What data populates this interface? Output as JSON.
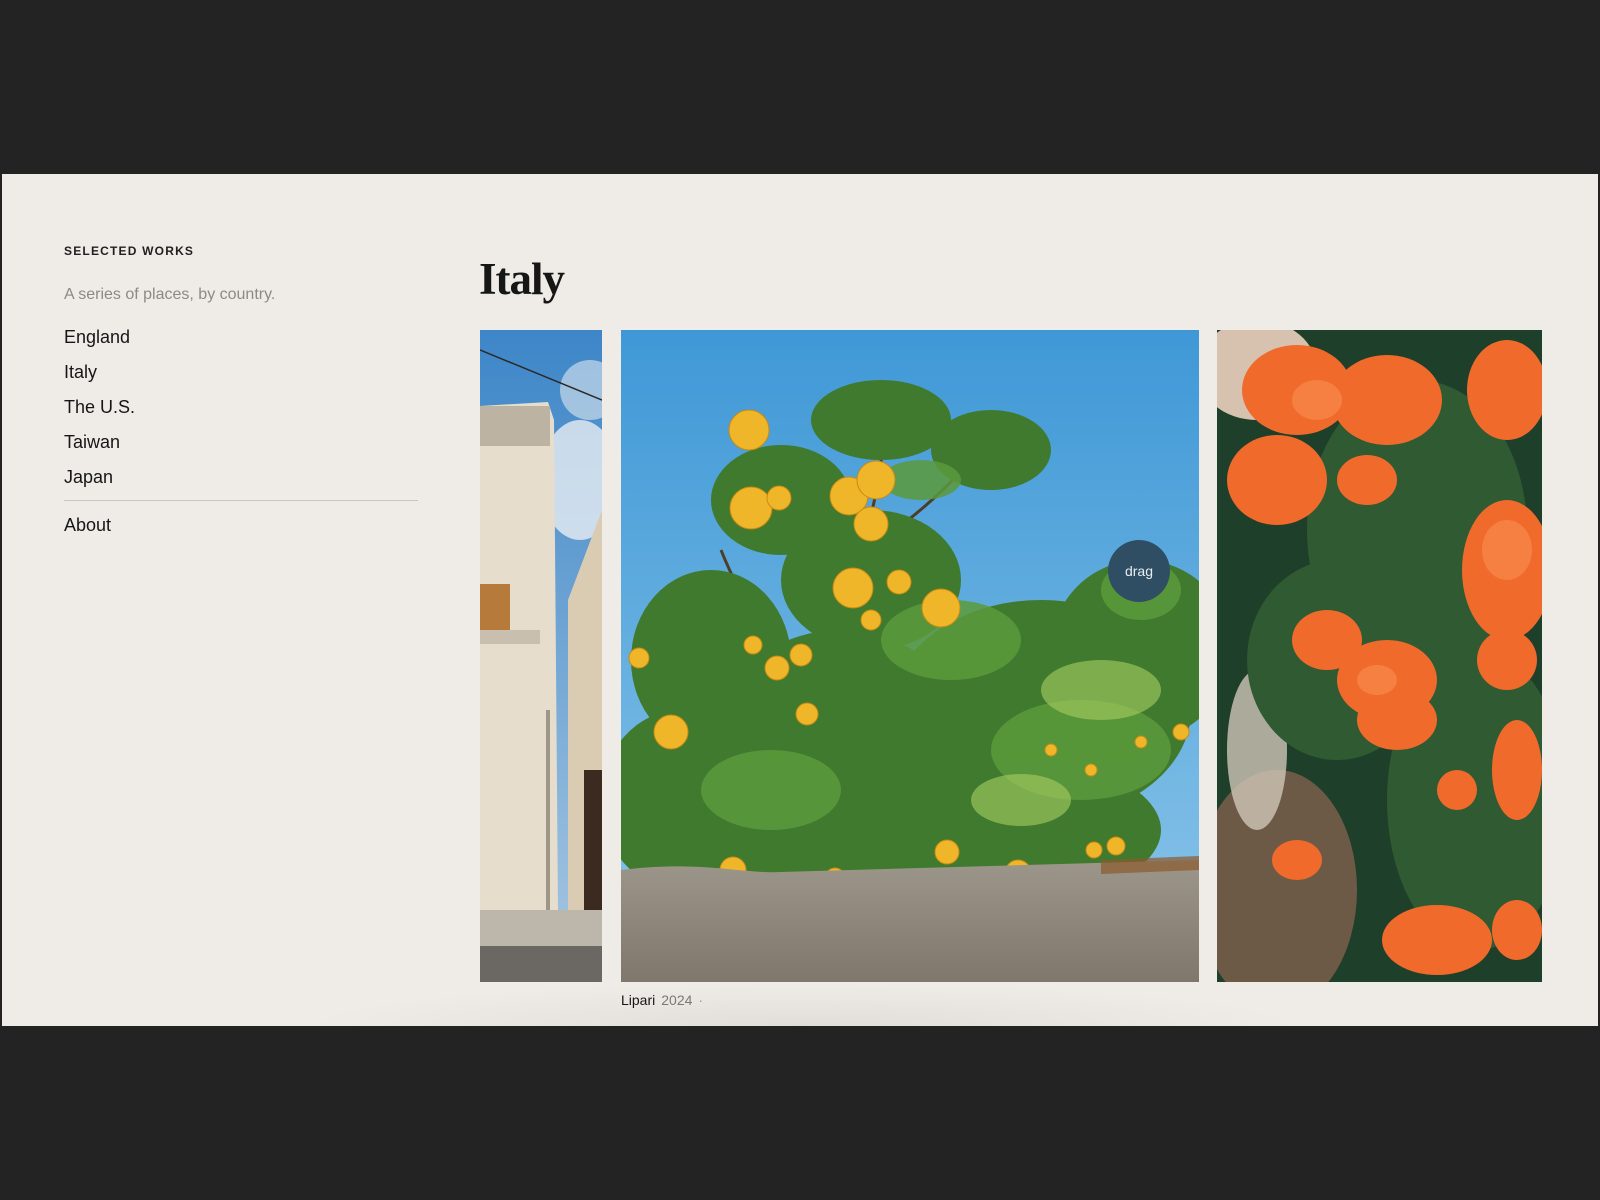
{
  "sidebar": {
    "eyebrow": "SELECTED WORKS",
    "tagline": "A series of places, by country.",
    "nav_items": [
      "England",
      "Italy",
      "The U.S.",
      "Taiwan",
      "Japan"
    ],
    "about": "About"
  },
  "gallery": {
    "heading": "Italy",
    "drag_label": "drag",
    "caption": {
      "place": "Lipari",
      "year": "2024",
      "separator": "·"
    },
    "photos": [
      "building-street-photo",
      "lemon-tree-photo",
      "orange-flowers-photo"
    ]
  },
  "colors": {
    "frame": "#232323",
    "page": "#efece7",
    "drag_badge": "#2f4e63",
    "sky": "#4a9fd6",
    "lemon": "#f0b62a",
    "flower": "#f06a2c"
  }
}
